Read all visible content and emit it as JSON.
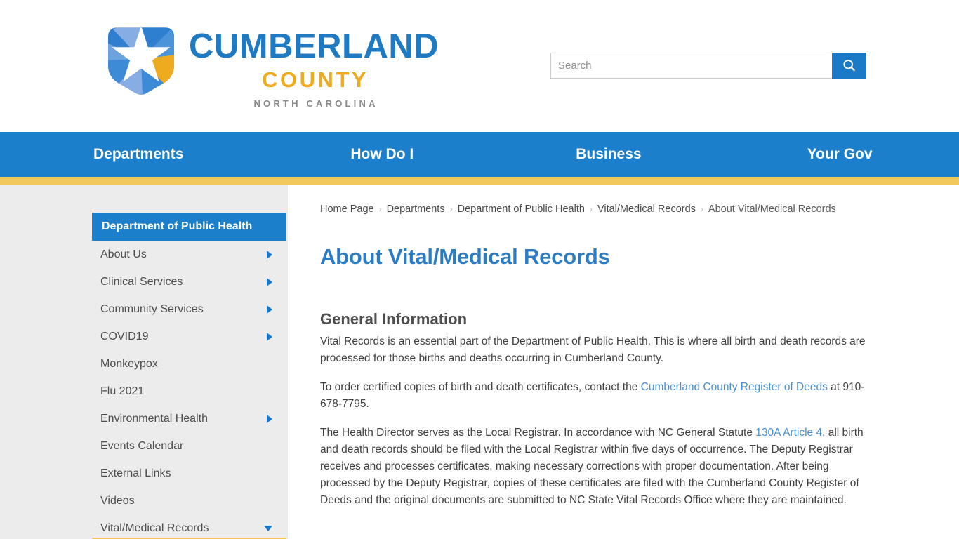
{
  "brand": {
    "name_line1": "CUMBERLAND",
    "name_line2": "COUNTY",
    "name_line3": "NORTH CAROLINA",
    "logo_icon": "cumberland-county-star-shield-logo",
    "blue": "#1f7ac4",
    "gold": "#eeab1f"
  },
  "search": {
    "placeholder": "Search",
    "value": "",
    "button_icon": "search-icon"
  },
  "nav": {
    "items": [
      {
        "label": "Departments"
      },
      {
        "label": "How Do I"
      },
      {
        "label": "Business"
      },
      {
        "label": "Your Gov"
      }
    ]
  },
  "sidebar": {
    "header": "Department of Public Health",
    "items": [
      {
        "label": "About Us",
        "caret": "right"
      },
      {
        "label": "Clinical Services",
        "caret": "right"
      },
      {
        "label": "Community Services",
        "caret": "right"
      },
      {
        "label": "COVID19",
        "caret": "right"
      },
      {
        "label": "Monkeypox",
        "caret": "none"
      },
      {
        "label": "Flu 2021",
        "caret": "none"
      },
      {
        "label": "Environmental Health",
        "caret": "right"
      },
      {
        "label": "Events Calendar",
        "caret": "none"
      },
      {
        "label": "External Links",
        "caret": "none"
      },
      {
        "label": "Videos",
        "caret": "none"
      },
      {
        "label": "Vital/Medical Records",
        "caret": "down"
      }
    ]
  },
  "breadcrumb": {
    "separator": "›",
    "items": [
      {
        "label": "Home Page",
        "current": false
      },
      {
        "label": "Departments",
        "current": false
      },
      {
        "label": "Department of Public Health",
        "current": false
      },
      {
        "label": "Vital/Medical Records",
        "current": false
      },
      {
        "label": "About Vital/Medical Records",
        "current": true
      }
    ]
  },
  "main": {
    "title": "About Vital/Medical Records",
    "section_heading": "General Information",
    "p1": "Vital Records is an essential part of the Department of Public Health. This is where all birth and death records are processed for those births and deaths occurring in Cumberland County.",
    "p2_before": "To order certified copies of birth and death certificates, contact the ",
    "p2_link": "Cumberland County Register of Deeds",
    "p2_after": " at 910-678-7795.",
    "p3_before": "The Health Director serves as the Local Registrar. In accordance with NC General Statute ",
    "p3_link": "130A Article 4",
    "p3_after": ", all birth and death records should be filed with the Local Registrar within five days of occurrence. The Deputy Registrar receives and processes certificates, making necessary corrections with proper documentation. After being processed by the Deputy Registrar, copies of these certificates are filed with the Cumberland County Register of Deeds and the original documents are submitted to NC State Vital Records Office where they are maintained."
  }
}
